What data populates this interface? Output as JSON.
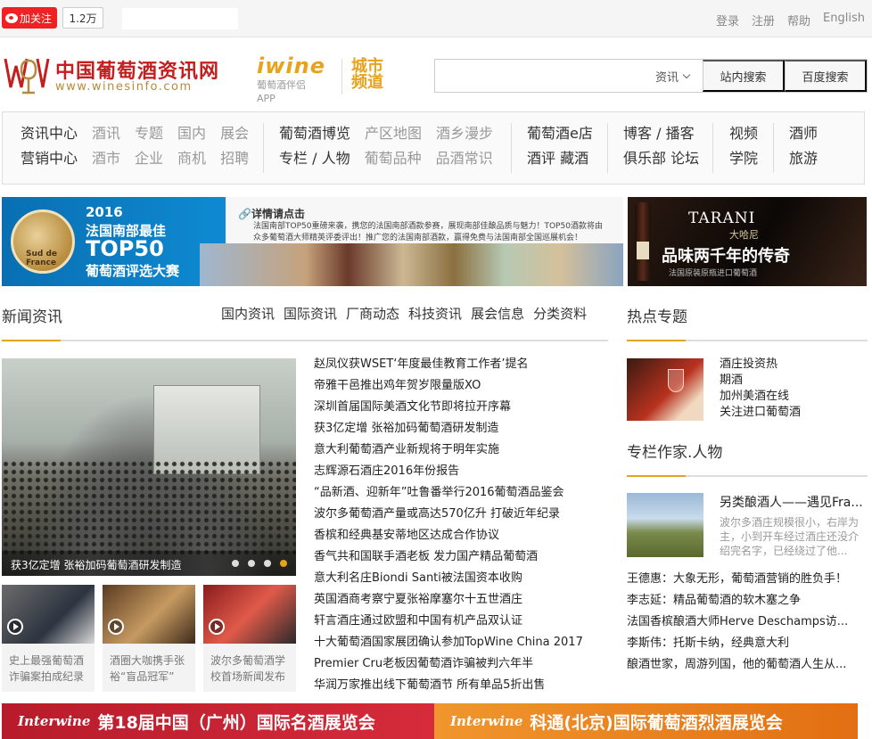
{
  "topbar": {
    "follow_label": "加关注",
    "follow_count": "1.2万",
    "links": [
      "登录",
      "注册",
      "帮助",
      "English"
    ]
  },
  "header": {
    "logo_cn": "中国葡萄酒资讯网",
    "logo_en": "www.winesinfo.com",
    "app_brand": "iwine",
    "app_sub1": "葡萄酒伴侣",
    "app_sub2": "APP",
    "city_line1": "城市",
    "city_line2": "频道",
    "search": {
      "placeholder": "",
      "category": "资讯",
      "site_search": "站内搜索",
      "baidu_search": "百度搜索"
    }
  },
  "nav": {
    "col1": [
      [
        "资讯中心",
        "酒讯",
        "专题",
        "国内",
        "展会"
      ],
      [
        "营销中心",
        "酒市",
        "企业",
        "商机",
        "招聘"
      ]
    ],
    "col2": [
      [
        "葡萄酒博览",
        "产区地图",
        "酒乡漫步"
      ],
      [
        "专栏 / 人物",
        "葡萄品种",
        "品酒常识"
      ]
    ],
    "col3": [
      [
        "葡萄酒e店"
      ],
      [
        "酒评  藏酒"
      ]
    ],
    "col4": [
      [
        "博客 / 播客"
      ],
      [
        "俱乐部 论坛"
      ]
    ],
    "col5": [
      [
        "视频"
      ],
      [
        "学院"
      ]
    ],
    "col6": [
      [
        "酒师"
      ],
      [
        "旅游"
      ]
    ]
  },
  "banner_left": {
    "year": "2016",
    "line": "法国南部最佳",
    "big": "TOP50",
    "sub": "葡萄酒评选大赛",
    "link": "详情请点击",
    "desc": "法国南部TOP50重磅来袭，携您的法国南部酒款参赛，展现南部佳酿品质与魅力！TOP50酒款将由众多葡萄酒大师精英评委评出！推广您的法国南部酒款，赢得免费与法国南部全国巡展机会！",
    "badge": "Sud de France"
  },
  "banner_right": {
    "brand": "TARANI",
    "brand_cn": "大哈尼",
    "slogan": "品味两千年的传奇",
    "small": "法国原装原瓶进口葡萄酒"
  },
  "news": {
    "title": "新闻资讯",
    "tabs": [
      "国内资讯",
      "国际资讯",
      "厂商动态",
      "科技资讯",
      "展会信息",
      "分类资料"
    ],
    "featured_caption": "获3亿定增 张裕加码葡萄酒研发制造",
    "videos": [
      {
        "title": "史上最强葡萄酒诈骗案拍成纪录"
      },
      {
        "title": "酒圈大咖携手张裕“盲品冠军”"
      },
      {
        "title": "波尔多葡萄酒学校首场新闻发布"
      }
    ],
    "items": [
      "赵凤仪获WSET‘年度最佳教育工作者’提名",
      "帝雅干邑推出鸡年贺岁限量版XO",
      "深圳首届国际美酒文化节即将拉开序幕",
      "获3亿定增 张裕加码葡萄酒研发制造",
      "意大利葡萄酒产业新规将于明年实施",
      "志辉源石酒庄2016年份报告",
      "“品新酒、迎新年”吐鲁番举行2016葡萄酒品鉴会",
      "波尔多葡萄酒产量或高达570亿升 打破近年纪录",
      "香槟和经典基安蒂地区达成合作协议",
      "香气共和国联手酒老板 发力国产精品葡萄酒",
      "意大利名庄Biondi Santi被法国资本收购",
      "英国酒商考察宁夏张裕摩塞尔十五世酒庄",
      "轩言酒庄通过欧盟和中国有机产品双认证",
      "十大葡萄酒国家展团确认参加TopWine China 2017",
      "Premier Cru老板因葡萄酒诈骗被判六年半",
      "华润万家推出线下葡萄酒节 所有单品5折出售"
    ]
  },
  "hot": {
    "title": "热点专题",
    "links": [
      "酒庄投资热",
      "期酒",
      "加州美酒在线",
      "关注进口葡萄酒"
    ]
  },
  "column": {
    "title": "专栏作家.人物",
    "feature_title": "另类酿酒人——遇见Fra...",
    "feature_desc": "波尔多酒庄规模很小，右岸为主，小到开车经过酒庄还没介绍完名字，已经绕过了他...",
    "items": [
      "王德惠：大象无形，葡萄酒营销的胜负手！",
      "李志延：精品葡萄酒的软木塞之争",
      "法国香槟酿酒大师Herve Deschamps访...",
      "李斯伟：托斯卡纳，经典意大利",
      "酿酒世家，周游列国，他的葡萄酒人生从..."
    ]
  },
  "bottom": {
    "left_logo": "Interwine",
    "left_text": "第18届中国（广州）国际名酒展览会",
    "right_logo": "Interwine",
    "right_text": "科通(北京)国际葡萄酒烈酒展览会"
  },
  "colors": {
    "accent": "#e8a21b",
    "brand_red": "#c41f1f"
  }
}
